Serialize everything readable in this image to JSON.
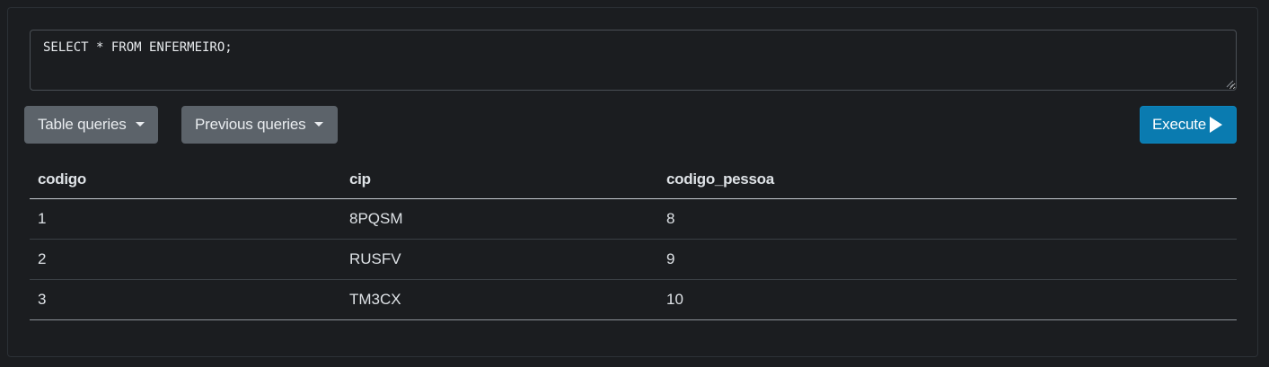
{
  "query": {
    "text": "SELECT * FROM ENFERMEIRO;"
  },
  "toolbar": {
    "table_queries_label": "Table queries",
    "previous_queries_label": "Previous queries",
    "execute_label": "Execute"
  },
  "results": {
    "headers": [
      "codigo",
      "cip",
      "codigo_pessoa"
    ],
    "rows": [
      [
        "1",
        "8PQSM",
        "8"
      ],
      [
        "2",
        "RUSFV",
        "9"
      ],
      [
        "3",
        "TM3CX",
        "10"
      ]
    ]
  },
  "colors": {
    "background": "#1b1d20",
    "secondary_button": "#5c636a",
    "execute_button": "#0a7bb0"
  },
  "icons": {
    "dropdown": "caret-down-icon",
    "execute": "play-icon",
    "resize": "resize-grip-icon"
  }
}
